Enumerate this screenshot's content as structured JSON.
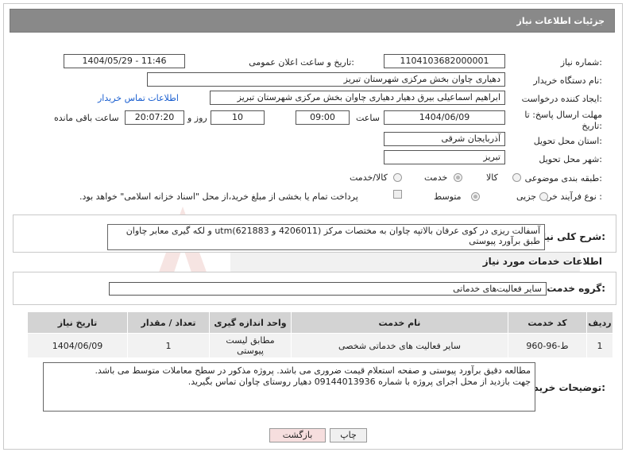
{
  "header": {
    "title": "جزئیات اطلاعات نیاز"
  },
  "fields": {
    "need_number_label": "شماره نیاز:",
    "need_number": "1104103682000001",
    "announce_label": "تاریخ و ساعت اعلان عمومی:",
    "announce_value": "1404/05/29 - 11:46",
    "buyer_org_label": "نام دستگاه خریدار:",
    "buyer_org": "دهیاری چاوان بخش مرکزی شهرستان تبریز",
    "creator_label": "ایجاد کننده درخواست:",
    "creator": "ابراهیم اسماعیلی بیرق دهیار دهیاری چاوان بخش مرکزی شهرستان تبریز",
    "contact_link": "اطلاعات تماس خریدار",
    "deadline_label_1": "مهلت ارسال پاسخ: تا",
    "deadline_label_2": "تاریخ:",
    "deadline_date": "1404/06/09",
    "time_label": "ساعت",
    "deadline_time": "09:00",
    "days": "10",
    "days_label": "روز و",
    "remaining_time": "20:07:20",
    "remaining_label": "ساعت باقی مانده",
    "province_label": "استان محل تحویل:",
    "province": "آذربایجان شرقی",
    "city_label": "شهر محل تحویل:",
    "city": "تبریز",
    "category_label": "طبقه بندی موضوعی:",
    "category_options": [
      "کالا",
      "خدمت",
      "کالا/خدمت"
    ],
    "process_label": "نوع فرآیند خرید :",
    "process_options": [
      "جزیی",
      "متوسط"
    ],
    "payment_note": "پرداخت تمام یا بخشی از مبلغ خرید،از محل \"اسناد خزانه اسلامی\" خواهد بود."
  },
  "description": {
    "label": "شرح کلی نیاز:",
    "text_line1": "آسفالت ریزی در کوی عرفان بالاتپه چاوان به مختصات مرکز (4206011 و utm(621883 و لکه گیری معابر چاوان",
    "text_line2": "طبق برآورد پیوستی"
  },
  "services": {
    "section_title": "اطلاعات خدمات مورد نیاز",
    "group_label": "گروه خدمت:",
    "group_value": "سایر فعالیت‌های خدماتی",
    "columns": [
      "ردیف",
      "کد خدمت",
      "نام خدمت",
      "واحد اندازه گیری",
      "تعداد / مقدار",
      "تاریخ نیاز"
    ],
    "rows": [
      {
        "row": "1",
        "code": "ط-96-960",
        "name": "سایر فعالیت های خدماتی شخصی",
        "unit_1": "مطابق لیست",
        "unit_2": "پیوستی",
        "qty": "1",
        "date": "1404/06/09"
      }
    ]
  },
  "buyer_notes": {
    "label": "توضیحات خریدار:",
    "line1": "مطالعه دقیق برآورد پیوستی و صفحه استعلام قیمت ضروری می باشد. پروژه مذکور در سطح معاملات متوسط می باشد.",
    "line2": "جهت بازدید از محل اجرای پروژه با شماره 09144013936 دهیار روستای چاوان تماس بگیرید."
  },
  "buttons": {
    "print": "چاپ",
    "back": "بازگشت"
  },
  "colors": {
    "header_bg": "#898989",
    "table_head": "#d3d3d3",
    "link": "#1a5fd0",
    "back_btn": "#f6dede"
  }
}
